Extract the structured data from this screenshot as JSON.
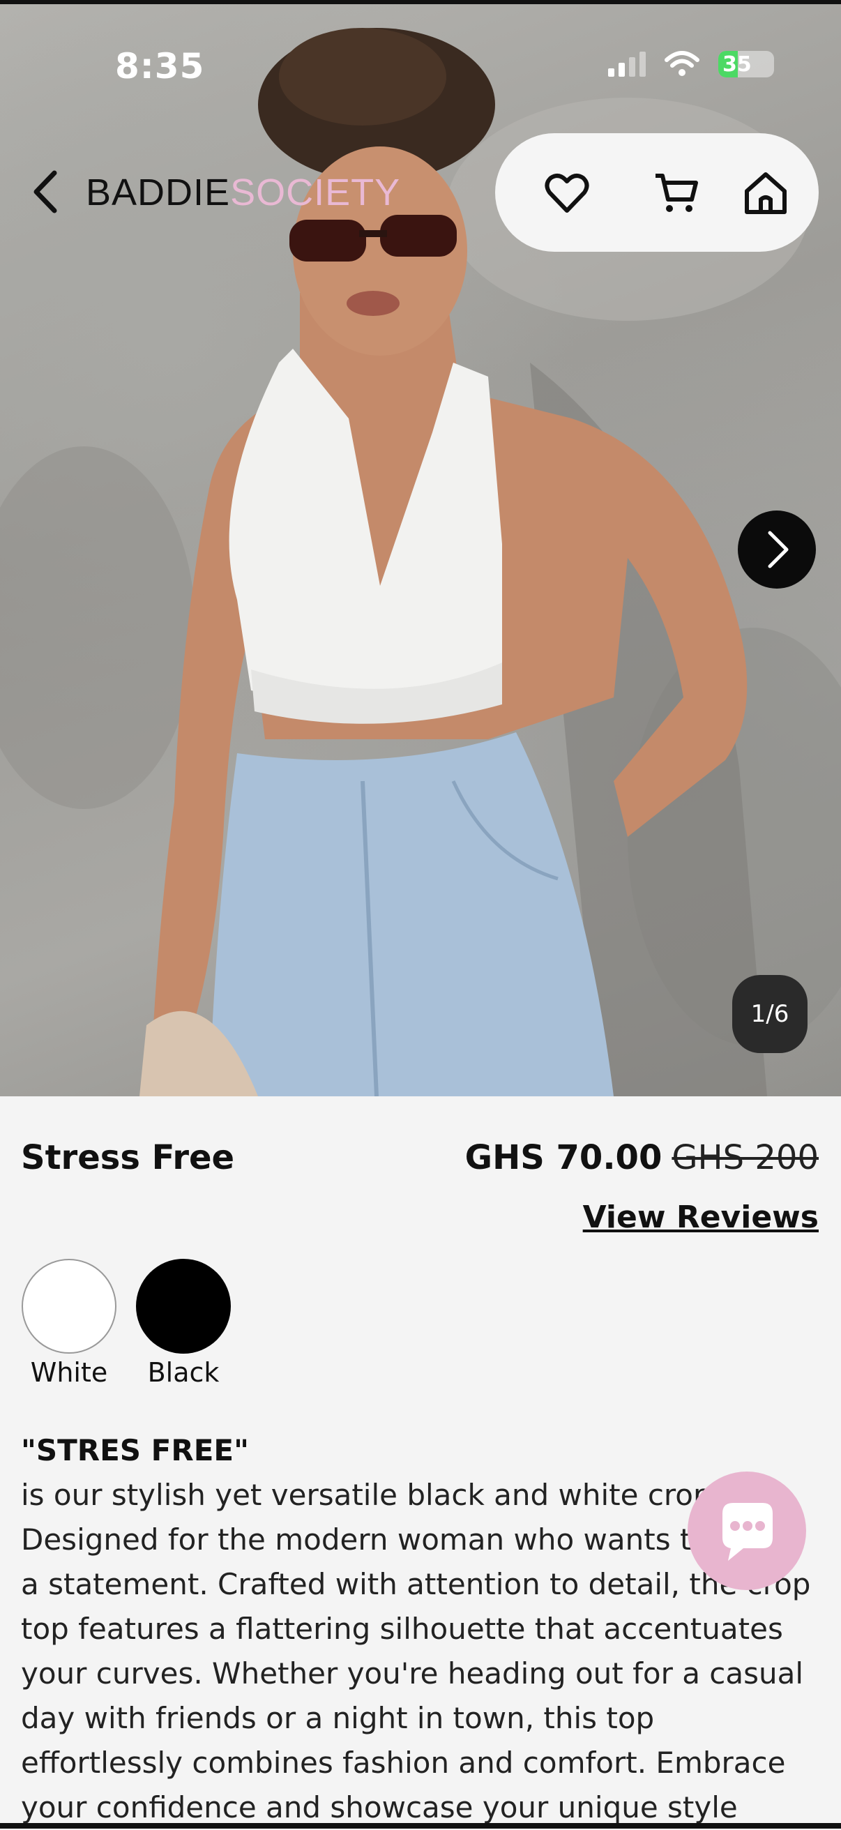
{
  "status_bar": {
    "time": "8:35",
    "battery_level": "35",
    "battery_fraction": 0.35,
    "icons": [
      "signal-icon",
      "wifi-icon",
      "battery-charging-icon"
    ]
  },
  "header": {
    "brand_part1": "BADDIE",
    "brand_part2": "SOCIETY",
    "brand_accent_color": "#e9b9d4",
    "actions": [
      "heart-icon",
      "cart-icon",
      "home-icon"
    ]
  },
  "carousel": {
    "counter": "1/6"
  },
  "product": {
    "name": "Stress Free",
    "price": "GHS 70.00",
    "old_price": "GHS 200",
    "view_reviews": "View Reviews",
    "colors": [
      {
        "label": "White",
        "hex": "#ffffff"
      },
      {
        "label": "Black",
        "hex": "#000000"
      }
    ],
    "description_title": "\"STRES FREE\"",
    "description": "is our stylish yet versatile black and white crop top. Designed for the modern woman who wants to make a statement. Crafted with attention to detail, the crop top features a flattering silhouette that accentuates your curves. Whether you're heading out for a casual day with friends or a night in town, this top effortlessly combines fashion and comfort. Embrace your confidence and showcase your unique style"
  },
  "chat_button": {
    "icon": "chat-bubble-icon",
    "color": "#e8b5cf"
  }
}
